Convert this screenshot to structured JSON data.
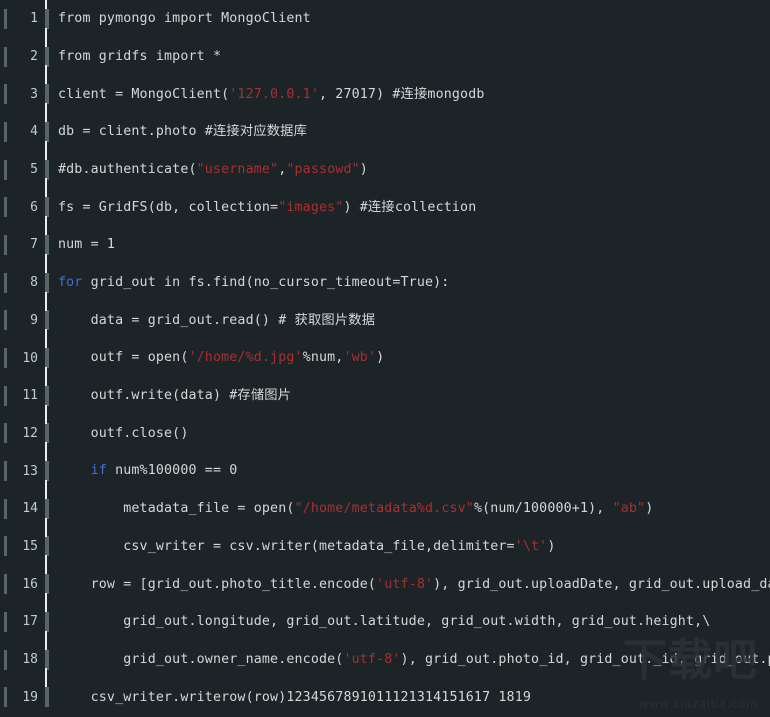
{
  "editor": {
    "language": "Python",
    "theme": {
      "background": "#1d2428",
      "foreground": "#d2d7d7",
      "line_number": "#c3cbcb",
      "gutter_mark": "#55666b",
      "caret_guide": "#e8ecec",
      "keyword": "#3d6fd6",
      "string": "#a82f2f"
    },
    "lines": [
      {
        "number": "1",
        "tokens": [
          {
            "t": "from pymongo import MongoClient",
            "c": "txt"
          }
        ]
      },
      {
        "number": "2",
        "tokens": [
          {
            "t": "from gridfs import *",
            "c": "txt"
          }
        ]
      },
      {
        "number": "3",
        "tokens": [
          {
            "t": "client = MongoClient(",
            "c": "txt"
          },
          {
            "t": "'127.0.0.1'",
            "c": "str"
          },
          {
            "t": ", 27017) #连接mongodb",
            "c": "txt"
          }
        ]
      },
      {
        "number": "4",
        "tokens": [
          {
            "t": "db = client.photo #连接对应数据库",
            "c": "txt"
          }
        ]
      },
      {
        "number": "5",
        "tokens": [
          {
            "t": "#db.authenticate(",
            "c": "txt"
          },
          {
            "t": "\"username\"",
            "c": "str"
          },
          {
            "t": ",",
            "c": "txt"
          },
          {
            "t": "\"passowd\"",
            "c": "str"
          },
          {
            "t": ")",
            "c": "txt"
          }
        ]
      },
      {
        "number": "6",
        "tokens": [
          {
            "t": "fs = GridFS(db, collection=",
            "c": "txt"
          },
          {
            "t": "\"images\"",
            "c": "str"
          },
          {
            "t": ") #连接collection",
            "c": "txt"
          }
        ]
      },
      {
        "number": "7",
        "tokens": [
          {
            "t": "num = 1",
            "c": "txt"
          }
        ]
      },
      {
        "number": "8",
        "tokens": [
          {
            "t": "for",
            "c": "kw"
          },
          {
            "t": " grid_out in fs.find(no_cursor_timeout=True):",
            "c": "txt"
          }
        ]
      },
      {
        "number": "9",
        "tokens": [
          {
            "t": "    data = grid_out.read() # 获取图片数据",
            "c": "txt"
          }
        ]
      },
      {
        "number": "10",
        "tokens": [
          {
            "t": "    outf = open(",
            "c": "txt"
          },
          {
            "t": "'/home/%d.jpg'",
            "c": "str"
          },
          {
            "t": "%num,",
            "c": "txt"
          },
          {
            "t": "'wb'",
            "c": "str"
          },
          {
            "t": ")",
            "c": "txt"
          }
        ]
      },
      {
        "number": "11",
        "tokens": [
          {
            "t": "    outf.write(data) #存储图片",
            "c": "txt"
          }
        ]
      },
      {
        "number": "12",
        "tokens": [
          {
            "t": "    outf.close()",
            "c": "txt"
          }
        ]
      },
      {
        "number": "13",
        "tokens": [
          {
            "t": "    ",
            "c": "txt"
          },
          {
            "t": "if",
            "c": "kw"
          },
          {
            "t": " num%100000 == 0",
            "c": "txt"
          }
        ]
      },
      {
        "number": "14",
        "tokens": [
          {
            "t": "        metadata_file = open(",
            "c": "txt"
          },
          {
            "t": "\"/home/metadata%d.csv\"",
            "c": "str"
          },
          {
            "t": "%(num/100000+1), ",
            "c": "txt"
          },
          {
            "t": "\"ab\"",
            "c": "str"
          },
          {
            "t": ")",
            "c": "txt"
          }
        ]
      },
      {
        "number": "15",
        "tokens": [
          {
            "t": "        csv_writer = csv.writer(metadata_file,delimiter=",
            "c": "txt"
          },
          {
            "t": "'\\t'",
            "c": "str"
          },
          {
            "t": ")",
            "c": "txt"
          }
        ]
      },
      {
        "number": "16",
        "tokens": [
          {
            "t": "    row = [grid_out.photo_title.encode(",
            "c": "txt"
          },
          {
            "t": "'utf-8'",
            "c": "str"
          },
          {
            "t": "), grid_out.uploadDate, grid_out.upload_date, \\",
            "c": "txt"
          }
        ]
      },
      {
        "number": "17",
        "tokens": [
          {
            "t": "        grid_out.longitude, grid_out.latitude, grid_out.width, grid_out.height,\\",
            "c": "txt"
          }
        ]
      },
      {
        "number": "18",
        "tokens": [
          {
            "t": "        grid_out.owner_name.encode(",
            "c": "txt"
          },
          {
            "t": "'utf-8'",
            "c": "str"
          },
          {
            "t": "), grid_out.photo_id, grid_out._id, grid_out.photo_url]",
            "c": "txt"
          }
        ]
      },
      {
        "number": "19",
        "tokens": [
          {
            "t": "    csv_writer.writerow(row)1234567891011121314151617 1819",
            "c": "txt"
          }
        ]
      }
    ]
  },
  "watermark": {
    "glyphs": "下载吧",
    "url": "www.xiazaiba.com"
  }
}
